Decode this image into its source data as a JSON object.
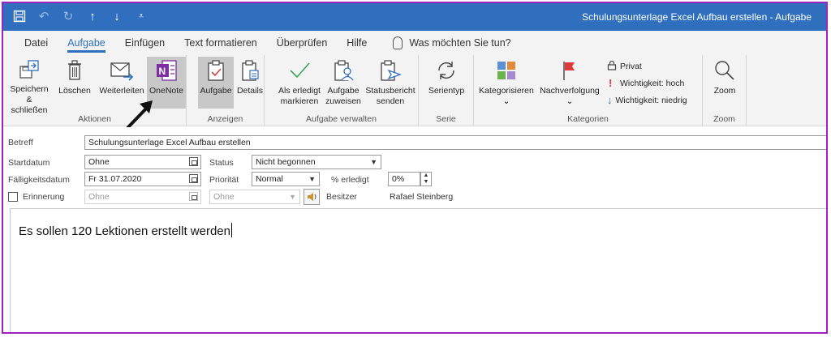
{
  "window": {
    "title": "Schulungsunterlage Excel Aufbau erstellen  -  Aufgabe"
  },
  "quick_access": {
    "save_icon": "save-icon",
    "undo_icon": "undo-icon",
    "redo_icon": "redo-icon",
    "up_icon": "arrow-up-icon",
    "down_icon": "arrow-down-icon",
    "customize_icon": "customize-qat-icon"
  },
  "tabs": [
    {
      "label": "Datei"
    },
    {
      "label": "Aufgabe",
      "active": true
    },
    {
      "label": "Einfügen"
    },
    {
      "label": "Text formatieren"
    },
    {
      "label": "Überprüfen"
    },
    {
      "label": "Hilfe"
    }
  ],
  "tell_me": "Was möchten Sie tun?",
  "ribbon": {
    "aktionen": {
      "label": "Aktionen",
      "save_close_1": "Speichern",
      "save_close_2": "& schließen",
      "delete": "Löschen",
      "forward": "Weiterleiten",
      "onenote": "OneNote"
    },
    "anzeigen": {
      "label": "Anzeigen",
      "task": "Aufgabe",
      "details": "Details"
    },
    "verwalten": {
      "label": "Aufgabe verwalten",
      "mark_done_1": "Als erledigt",
      "mark_done_2": "markieren",
      "assign_1": "Aufgabe",
      "assign_2": "zuweisen",
      "status_1": "Statusbericht",
      "status_2": "senden"
    },
    "serie": {
      "label": "Serie",
      "recurrence": "Serientyp"
    },
    "kategorien": {
      "label": "Kategorien",
      "categorize": "Kategorisieren",
      "followup": "Nachverfolgung",
      "private": "Privat",
      "importance_high": "Wichtigkeit: hoch",
      "importance_low": "Wichtigkeit: niedrig"
    },
    "zoom": {
      "label": "Zoom",
      "zoom": "Zoom"
    }
  },
  "form": {
    "subject_label": "Betreff",
    "subject_value": "Schulungsunterlage Excel Aufbau erstellen",
    "start_label": "Startdatum",
    "start_value": "Ohne",
    "due_label": "Fälligkeitsdatum",
    "due_value": "Fr 31.07.2020",
    "reminder_label": "Erinnerung",
    "reminder_date": "Ohne",
    "reminder_time": "Ohne",
    "status_label": "Status",
    "status_value": "Nicht begonnen",
    "priority_label": "Priorität",
    "priority_value": "Normal",
    "percent_label": "% erledigt",
    "percent_value": "0%",
    "owner_label": "Besitzer",
    "owner_value": "Rafael Steinberg"
  },
  "body": {
    "text": "Es sollen 120 Lektionen erstellt werden"
  },
  "colors": {
    "titlebar": "#2f6fbd",
    "frame": "#a020c0",
    "onenote": "#7b2fa0",
    "flag": "#e0383c"
  }
}
